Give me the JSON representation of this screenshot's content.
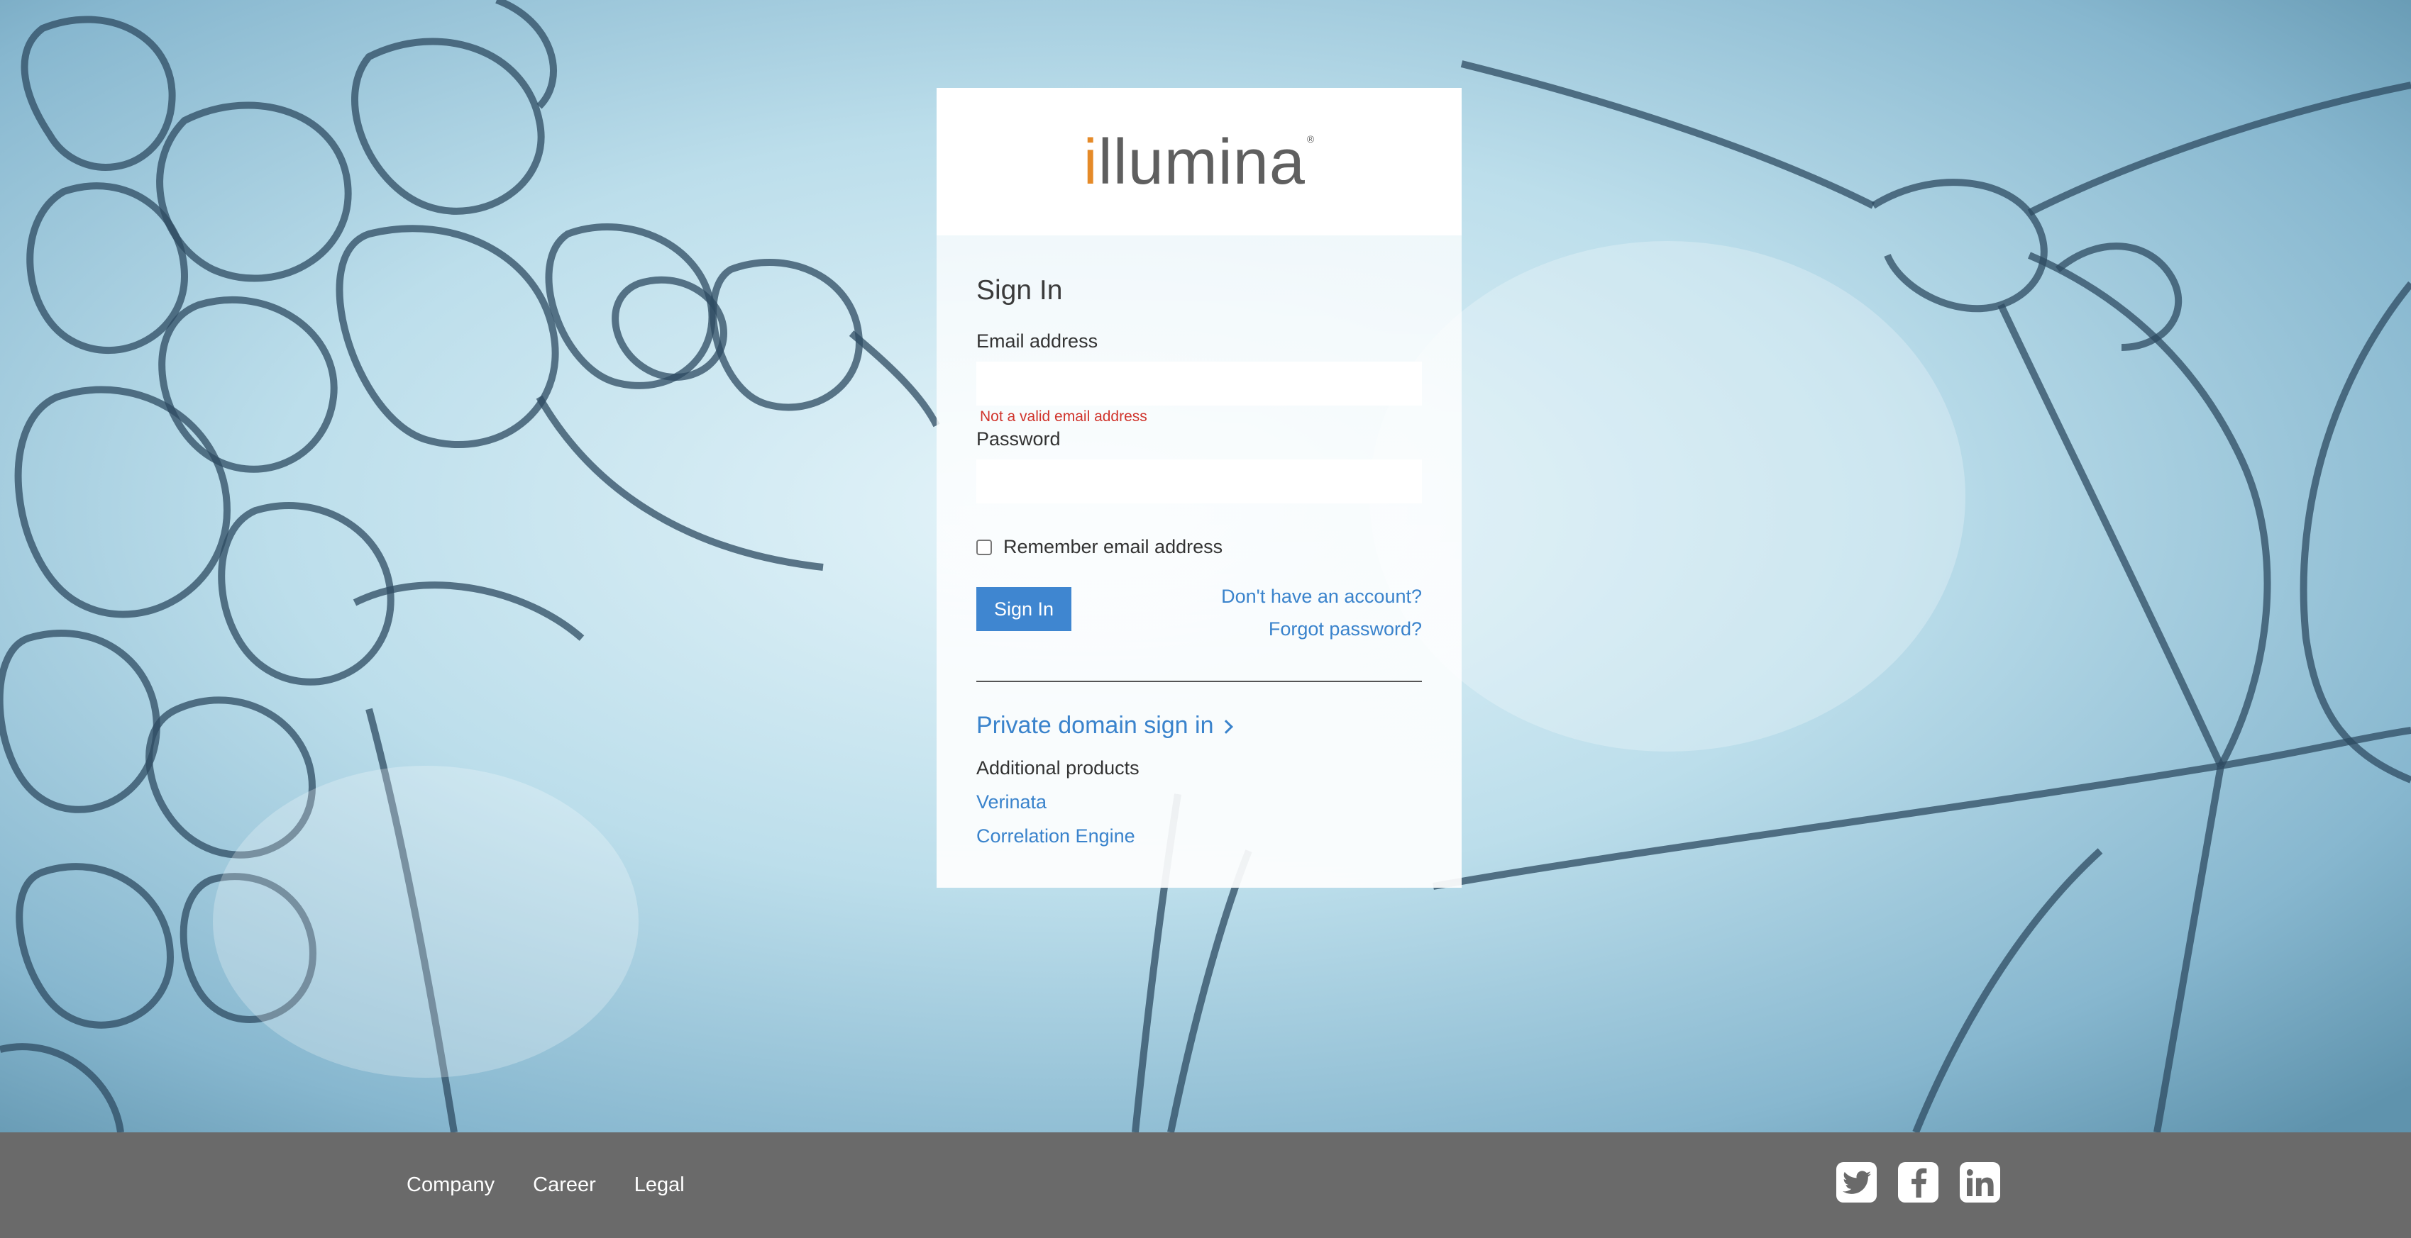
{
  "logo": {
    "first_letter": "i",
    "rest": "llumina",
    "registered": "®"
  },
  "signin": {
    "title": "Sign In",
    "email_label": "Email address",
    "email_value": "",
    "email_error": "Not a valid email address",
    "password_label": "Password",
    "password_value": "",
    "remember_label": "Remember email address",
    "remember_checked": false,
    "submit_label": "Sign In",
    "no_account_link": "Don't have an account?",
    "forgot_link": "Forgot password?",
    "private_domain_link": "Private domain sign in",
    "additional_heading": "Additional products",
    "products": [
      "Verinata",
      "Correlation Engine"
    ]
  },
  "footer": {
    "links": [
      "Company",
      "Career",
      "Legal"
    ],
    "social": [
      "twitter-icon",
      "facebook-icon",
      "linkedin-icon"
    ]
  },
  "colors": {
    "accent": "#3f86d0",
    "link": "#3a83cc",
    "error": "#d0342c",
    "logo_orange": "#e58a28",
    "footer_bg": "#6a6a6a"
  }
}
